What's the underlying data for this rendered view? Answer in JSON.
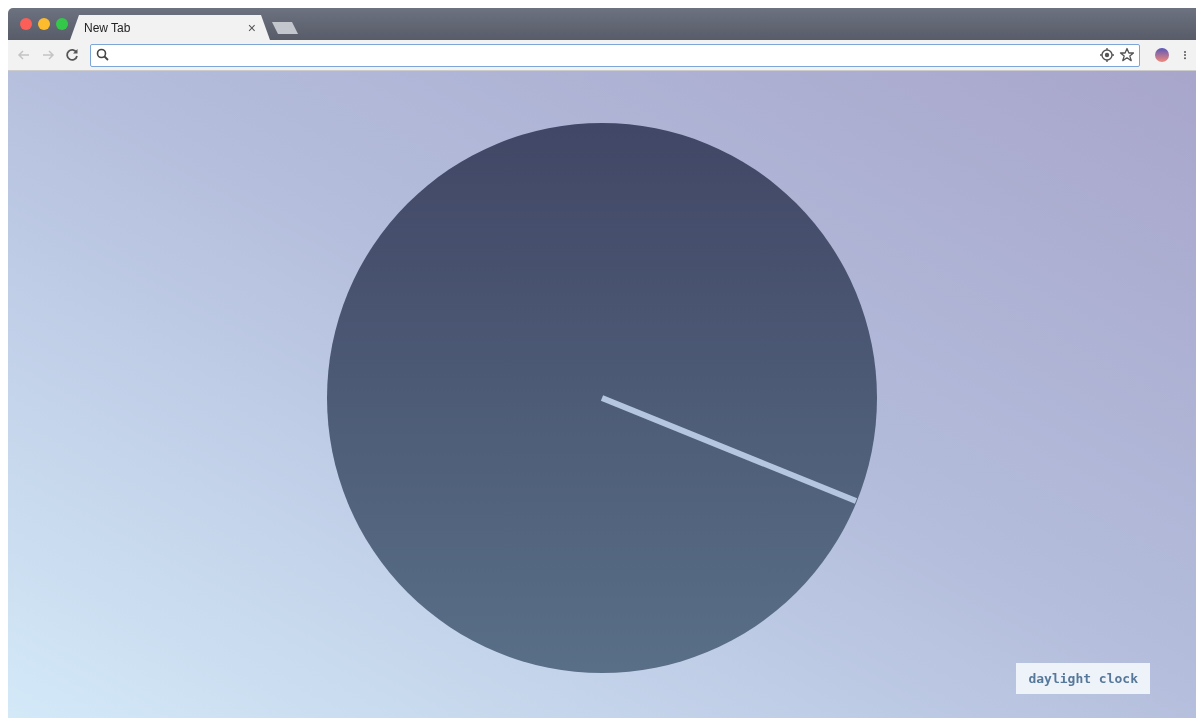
{
  "tabs": [
    {
      "label": "New Tab",
      "selected": true,
      "close": "×"
    }
  ],
  "label": "daylight clock"
}
